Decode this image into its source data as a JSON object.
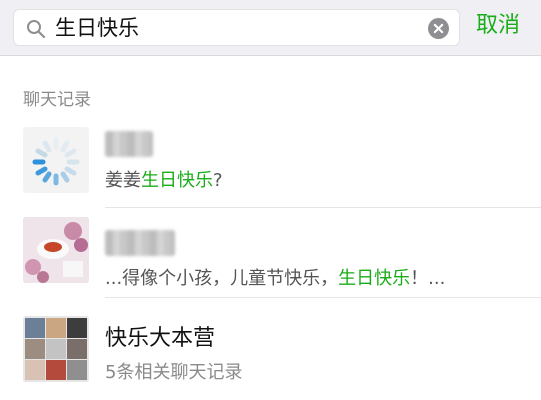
{
  "search": {
    "query": "生日快乐",
    "cancel_label": "取消"
  },
  "section": {
    "title": "聊天记录"
  },
  "results": [
    {
      "snippet_before": "姜姜",
      "snippet_highlight": "生日快乐",
      "snippet_after": "?"
    },
    {
      "snippet_before": "...得像个小孩，儿童节快乐，",
      "snippet_highlight": "生日快乐",
      "snippet_after": "！..."
    },
    {
      "name": "快乐大本营",
      "subtitle": "5条相关聊天记录"
    }
  ],
  "colors": {
    "accent": "#1aad19",
    "header_bg": "#efeff4",
    "muted_text": "#8a8a8a"
  },
  "icons": {
    "search": "search-icon",
    "clear": "clear-icon",
    "loading": "loading-spinner-icon"
  }
}
